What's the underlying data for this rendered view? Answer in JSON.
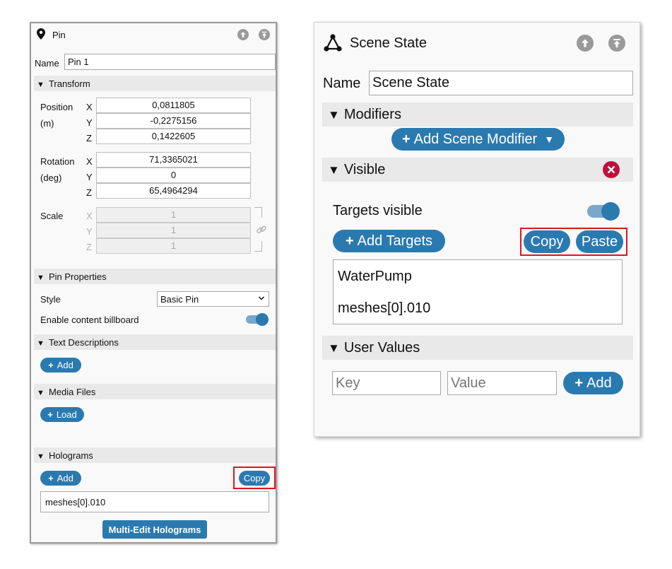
{
  "pin_panel": {
    "title": "Pin",
    "name_label": "Name",
    "name_value": "Pin 1",
    "transform": {
      "header": "Transform",
      "position_label": "Position",
      "position_unit": "(m)",
      "position": {
        "x": "0,0811805",
        "y": "-0,2275156",
        "z": "0,1422605"
      },
      "rotation_label": "Rotation",
      "rotation_unit": "(deg)",
      "rotation": {
        "x": "71,3365021",
        "y": "0",
        "z": "65,4964294"
      },
      "scale_label": "Scale",
      "scale": {
        "x": "1",
        "y": "1",
        "z": "1"
      },
      "axis": {
        "x": "X",
        "y": "Y",
        "z": "Z"
      }
    },
    "pin_properties": {
      "header": "Pin Properties",
      "style_label": "Style",
      "style_value": "Basic Pin",
      "billboard_label": "Enable content billboard",
      "billboard_on": true
    },
    "text_descriptions": {
      "header": "Text Descriptions",
      "add_label": "Add"
    },
    "media_files": {
      "header": "Media Files",
      "load_label": "Load"
    },
    "holograms": {
      "header": "Holograms",
      "add_label": "Add",
      "copy_label": "Copy",
      "list_value": "meshes[0].010",
      "multi_edit_label": "Multi-Edit Holograms"
    }
  },
  "scene_panel": {
    "title": "Scene State",
    "name_label": "Name",
    "name_value": "Scene State",
    "modifiers": {
      "header": "Modifiers",
      "add_label": "Add Scene Modifier"
    },
    "visible": {
      "header": "Visible",
      "targets_visible_label": "Targets visible",
      "targets_visible_on": true,
      "add_targets_label": "Add Targets",
      "copy_label": "Copy",
      "paste_label": "Paste",
      "targets": [
        "WaterPump",
        "meshes[0].010"
      ]
    },
    "user_values": {
      "header": "User Values",
      "key_placeholder": "Key",
      "value_placeholder": "Value",
      "add_label": "Add"
    }
  },
  "colors": {
    "accent": "#2a7ab0",
    "highlight": "#e0141e",
    "remove": "#c0103a",
    "section_bg": "#e9e9e9"
  }
}
